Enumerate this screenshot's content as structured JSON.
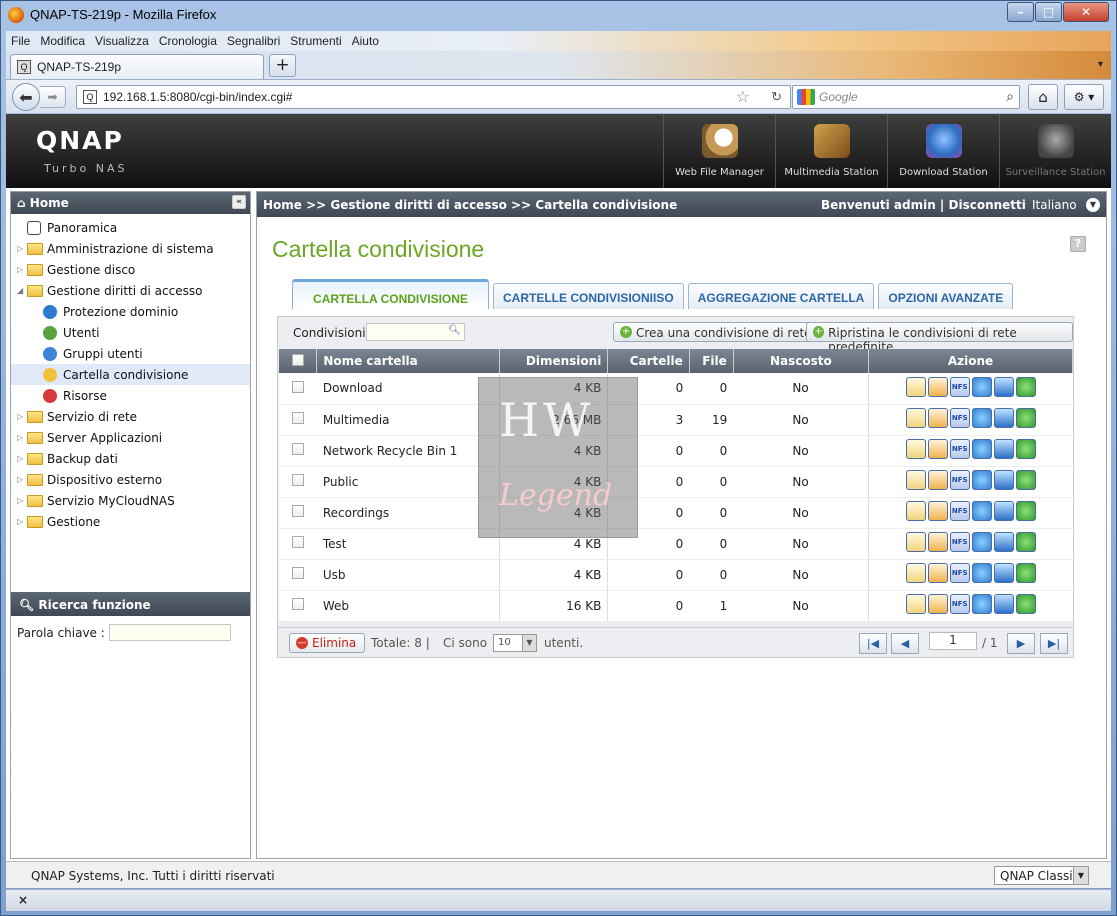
{
  "browser": {
    "window_title": "QNAP-TS-219p - Mozilla Firefox",
    "menu": [
      "File",
      "Modifica",
      "Visualizza",
      "Cronologia",
      "Segnalibri",
      "Strumenti",
      "Aiuto"
    ],
    "tab_title": "QNAP-TS-219p",
    "new_tab": "+",
    "url": "192.168.1.5:8080/cgi-bin/index.cgi#",
    "search_placeholder": "Google",
    "tab_icon_letter": "Q"
  },
  "header": {
    "logo": "QNAP",
    "subtitle": "Turbo NAS",
    "apps": [
      {
        "label": "Web File Manager",
        "icon": "web-file-manager-icon"
      },
      {
        "label": "Multimedia Station",
        "icon": "multimedia-station-icon"
      },
      {
        "label": "Download Station",
        "icon": "download-station-icon"
      },
      {
        "label": "Surveillance Station",
        "icon": "surveillance-station-icon"
      }
    ]
  },
  "sidebar": {
    "title": "Home",
    "collapse": "«",
    "items": [
      {
        "label": "Panoramica",
        "level": 0
      },
      {
        "label": "Amministrazione di sistema",
        "level": 1
      },
      {
        "label": "Gestione disco",
        "level": 1
      },
      {
        "label": "Gestione diritti di accesso",
        "level": 1,
        "expanded": true
      },
      {
        "label": "Protezione dominio",
        "level": 2
      },
      {
        "label": "Utenti",
        "level": 2
      },
      {
        "label": "Gruppi utenti",
        "level": 2
      },
      {
        "label": "Cartella condivisione",
        "level": 2,
        "selected": true
      },
      {
        "label": "Risorse",
        "level": 2
      },
      {
        "label": "Servizio di rete",
        "level": 1
      },
      {
        "label": "Server Applicazioni",
        "level": 1
      },
      {
        "label": "Backup dati",
        "level": 1
      },
      {
        "label": "Dispositivo esterno",
        "level": 1
      },
      {
        "label": "Servizio MyCloudNAS",
        "level": 1
      },
      {
        "label": "Gestione",
        "level": 1
      }
    ],
    "search_title": "Ricerca funzione",
    "keyword_label": "Parola chiave :"
  },
  "main": {
    "breadcrumb": "Home >> Gestione diritti di accesso >> Cartella condivisione",
    "welcome": "Benvenuti admin | Disconnetti",
    "language": "Italiano",
    "page_title": "Cartella condivisione",
    "help": "?",
    "tabs": [
      "CARTELLA CONDIVISIONE",
      "CARTELLE CONDIVISIONIISO",
      "AGGREGAZIONE CARTELLA",
      "OPZIONI AVANZATE"
    ],
    "filter_label": "Condivisioni",
    "create_button": "Crea una condivisione di rete",
    "restore_button": "Ripristina le condivisioni di rete predefinite",
    "columns": [
      "Nome cartella",
      "Dimensioni",
      "Cartelle",
      "File",
      "Nascosto",
      "Azione"
    ],
    "rows": [
      {
        "name": "Download",
        "size": "4 KB",
        "folders": "0",
        "files": "0",
        "hidden": "No"
      },
      {
        "name": "Multimedia",
        "size": "2.66 MB",
        "folders": "3",
        "files": "19",
        "hidden": "No"
      },
      {
        "name": "Network Recycle Bin 1",
        "size": "4 KB",
        "folders": "0",
        "files": "0",
        "hidden": "No"
      },
      {
        "name": "Public",
        "size": "4 KB",
        "folders": "0",
        "files": "0",
        "hidden": "No"
      },
      {
        "name": "Recordings",
        "size": "4 KB",
        "folders": "0",
        "files": "0",
        "hidden": "No"
      },
      {
        "name": "Test",
        "size": "4 KB",
        "folders": "0",
        "files": "0",
        "hidden": "No"
      },
      {
        "name": "Usb",
        "size": "4 KB",
        "folders": "0",
        "files": "0",
        "hidden": "No"
      },
      {
        "name": "Web",
        "size": "16 KB",
        "folders": "0",
        "files": "1",
        "hidden": "No"
      }
    ],
    "action_icons": [
      "edit-icon",
      "permissions-icon",
      "nfs-icon",
      "network-icon",
      "monitor-icon",
      "refresh-icon"
    ],
    "nfs_text": "NFS",
    "footer": {
      "delete": "Elimina",
      "total": "Totale: 8  |",
      "per_page_label": "Ci sono",
      "per_page_value": "10",
      "per_page_suffix": "utenti.",
      "page": "1",
      "page_total": "/ 1"
    }
  },
  "watermark": {
    "line1": "HW",
    "line2": "Legend"
  },
  "footer": {
    "copyright": "QNAP Systems, Inc. Tutti i diritti riservati",
    "theme": "QNAP Classic"
  },
  "statusbar": {
    "close": "×"
  }
}
